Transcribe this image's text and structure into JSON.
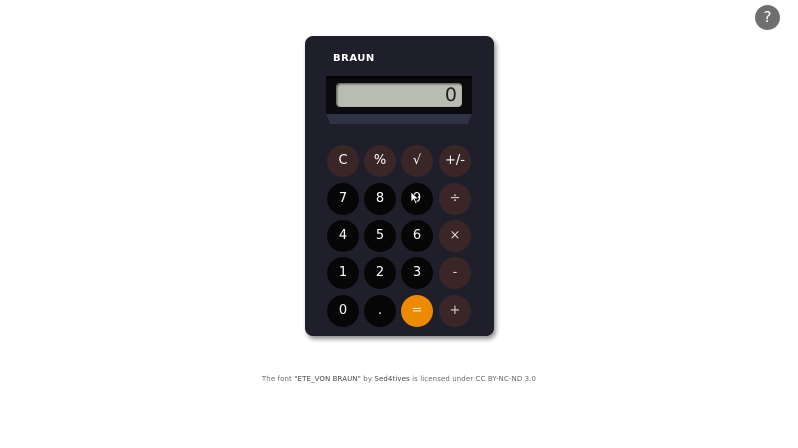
{
  "help": {
    "label": "?"
  },
  "calculator": {
    "brand": "BRAUN",
    "display_value": "0",
    "keys": [
      [
        "C",
        "%",
        "√",
        "+/-"
      ],
      [
        "7",
        "8",
        "9",
        "÷"
      ],
      [
        "4",
        "5",
        "6",
        "×"
      ],
      [
        "1",
        "2",
        "3",
        "-"
      ],
      [
        "0",
        ".",
        "=",
        "+"
      ]
    ]
  },
  "footer": {
    "prefix": "The font",
    "font_name": "\"ETE_VON BRAUN\"",
    "by": "by",
    "author": "Sed4tives",
    "license_text": "is licensed under CC BY-NC-ND 3.0"
  },
  "colors": {
    "body": "#1f1f2b",
    "function_key": "#3a2627",
    "number_key": "#060606",
    "equals_key": "#ee8a00",
    "lcd": "#b9bdb1"
  }
}
